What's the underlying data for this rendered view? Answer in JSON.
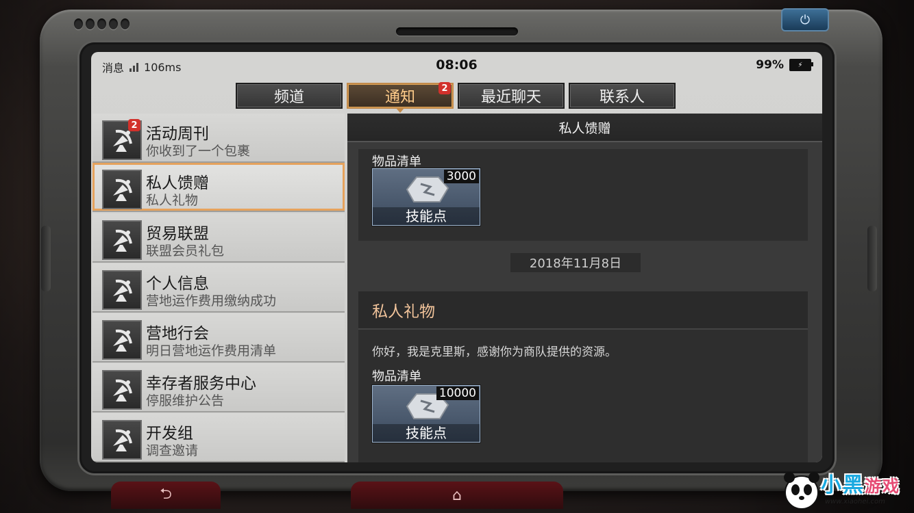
{
  "status_bar": {
    "messages_label": "消息",
    "latency": "106ms",
    "time": "08:06",
    "battery": "99%"
  },
  "tabs": [
    {
      "label": "频道",
      "active": false,
      "badge": ""
    },
    {
      "label": "通知",
      "active": true,
      "badge": "2"
    },
    {
      "label": "最近聊天",
      "active": false,
      "badge": ""
    },
    {
      "label": "联系人",
      "active": false,
      "badge": ""
    }
  ],
  "list": [
    {
      "title": "活动周刊",
      "subtitle": "你收到了一个包裹",
      "badge": "2",
      "selected": false
    },
    {
      "title": "私人馈赠",
      "subtitle": "私人礼物",
      "badge": "",
      "selected": true
    },
    {
      "title": "贸易联盟",
      "subtitle": "联盟会员礼包",
      "badge": "",
      "selected": false
    },
    {
      "title": "个人信息",
      "subtitle": "营地运作费用缴纳成功",
      "badge": "",
      "selected": false
    },
    {
      "title": "营地行会",
      "subtitle": "明日营地运作费用清单",
      "badge": "",
      "selected": false
    },
    {
      "title": "幸存者服务中心",
      "subtitle": "停服维护公告",
      "badge": "",
      "selected": false
    },
    {
      "title": "开发组",
      "subtitle": "调查邀请",
      "badge": "",
      "selected": false
    }
  ],
  "detail": {
    "header": "私人馈赠",
    "first_card": {
      "label": "物品清单",
      "reward_qty": "3000",
      "reward_name": "技能点"
    },
    "date": "2018年11月8日",
    "message": {
      "title": "私人礼物",
      "body": "你好，我是克里斯，感谢你为商队提供的资源。",
      "label": "物品清单",
      "reward_qty": "10000",
      "reward_name": "技能点"
    }
  },
  "buttons": {
    "power_icon": "power-icon",
    "back_icon": "back-icon",
    "home_icon": "home-icon"
  },
  "watermark": {
    "main": "小黑",
    "game": "游戏",
    "url": "www.xiaohei.com"
  },
  "colors": {
    "accent": "#e6a25c",
    "badge": "#d2312b",
    "active_tab_text": "#ffcc8a"
  }
}
